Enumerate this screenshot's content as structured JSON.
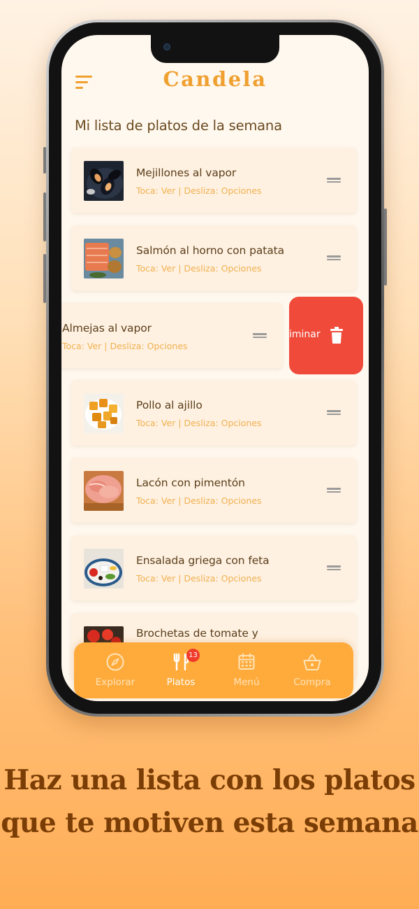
{
  "app": {
    "title": "Candela",
    "section_title": "Mi lista de platos de la semana"
  },
  "hint_text": "Toca: Ver | Desliza: Opciones",
  "dishes": [
    {
      "name": "Mejillones al vapor",
      "hint": "Toca: Ver | Desliza: Opciones"
    },
    {
      "name": "Salmón al horno con patata",
      "hint": "Toca: Ver | Desliza: Opciones"
    },
    {
      "name": "Almejas al vapor",
      "hint": "Toca: Ver | Desliza: Opciones",
      "swiped": true
    },
    {
      "name": "Pollo al ajillo",
      "hint": "Toca: Ver | Desliza: Opciones"
    },
    {
      "name": "Lacón con pimentón",
      "hint": "Toca: Ver | Desliza: Opciones"
    },
    {
      "name": "Ensalada griega con feta",
      "hint": "Toca: Ver | Desliza: Opciones"
    },
    {
      "name": "Brochetas de tomate y",
      "hint": ""
    }
  ],
  "swipe_action": {
    "label": "iminar"
  },
  "tabs": [
    {
      "label": "Explorar",
      "icon": "compass-icon",
      "active": false
    },
    {
      "label": "Platos",
      "icon": "fork-knife-icon",
      "active": true,
      "badge": "13"
    },
    {
      "label": "Menú",
      "icon": "calendar-icon",
      "active": false
    },
    {
      "label": "Compra",
      "icon": "basket-icon",
      "active": false
    }
  ],
  "tagline": {
    "line1": "Haz una lista con los platos",
    "line2": "que te motiven esta semana"
  },
  "colors": {
    "accent": "#f0a030",
    "tabbar": "#ffab3c",
    "delete": "#f04a3a",
    "badge": "#f03a2a",
    "tagline": "#7a3d05"
  }
}
